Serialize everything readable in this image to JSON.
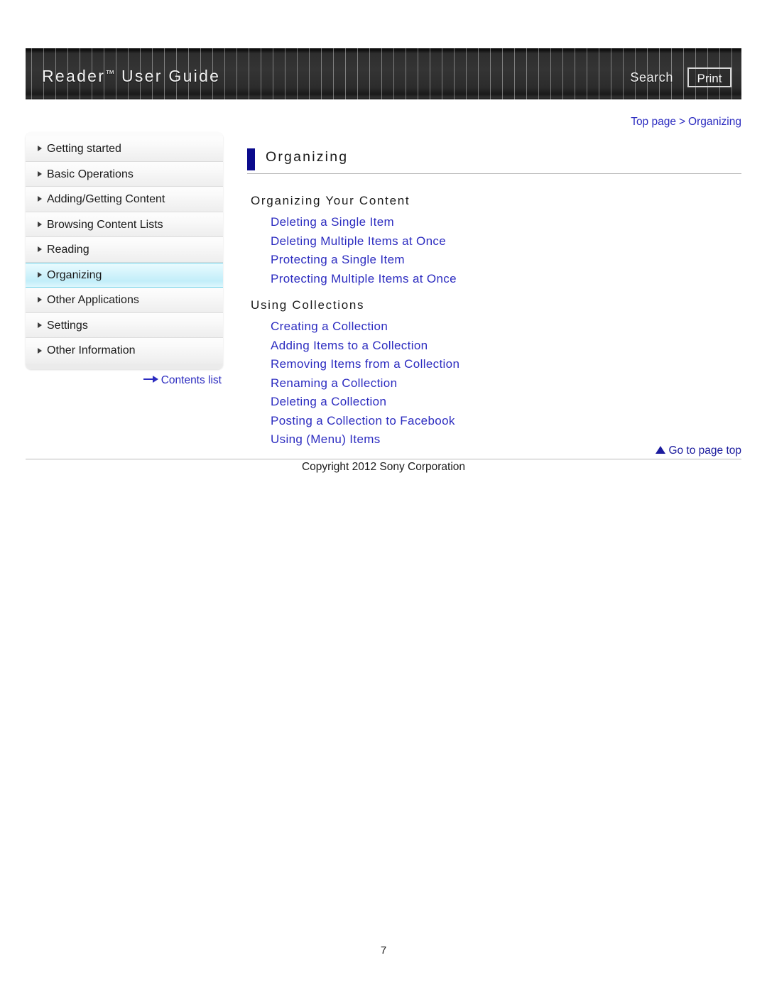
{
  "header": {
    "title_main": "Reader",
    "title_tm": "™",
    "title_rest": " User Guide",
    "search_label": "Search",
    "print_label": "Print"
  },
  "breadcrumb": {
    "top_page": "Top page",
    "separator": ">",
    "current": "Organizing"
  },
  "sidebar": {
    "items": [
      {
        "label": "Getting started",
        "active": false
      },
      {
        "label": "Basic Operations",
        "active": false
      },
      {
        "label": "Adding/Getting Content",
        "active": false
      },
      {
        "label": "Browsing Content Lists",
        "active": false
      },
      {
        "label": "Reading",
        "active": false
      },
      {
        "label": "Organizing",
        "active": true
      },
      {
        "label": "Other Applications",
        "active": false
      },
      {
        "label": "Settings",
        "active": false
      },
      {
        "label": "Other Information",
        "active": false
      }
    ],
    "contents_list_label": "Contents list"
  },
  "main": {
    "page_heading": "Organizing",
    "sections": [
      {
        "heading": "Organizing Your Content",
        "links": [
          "Deleting a Single Item",
          "Deleting Multiple Items at Once",
          "Protecting a Single Item",
          "Protecting Multiple Items at Once"
        ]
      },
      {
        "heading": "Using Collections",
        "links": [
          "Creating a Collection",
          "Adding Items to a Collection",
          "Removing Items from a Collection",
          "Renaming a Collection",
          "Deleting a Collection",
          "Posting a Collection to Facebook",
          "Using (Menu) Items"
        ]
      }
    ]
  },
  "footer": {
    "go_to_top_label": "Go to page top",
    "copyright": "Copyright 2012 Sony Corporation",
    "page_number": "7"
  },
  "colors": {
    "link_blue": "#2c2cc0",
    "heading_bar_navy": "#0a0a8c",
    "active_nav_cyan": "#c2eef9",
    "header_dark": "#2e2e2e"
  }
}
